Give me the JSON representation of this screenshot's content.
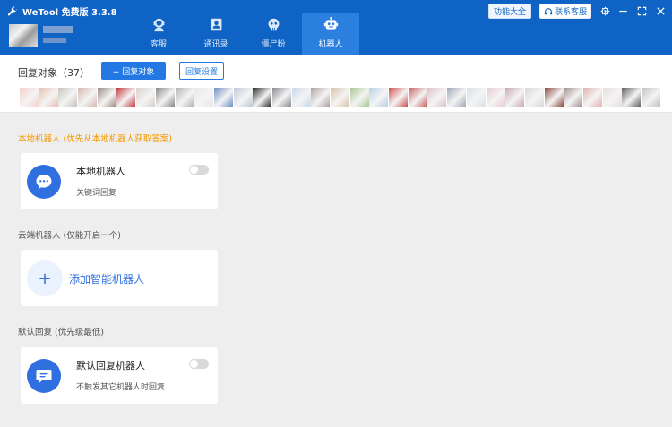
{
  "app": {
    "title": "WeTool 免费版 3.3.8"
  },
  "nav": {
    "tabs": [
      {
        "label": "客服",
        "icon": "customer-service-icon"
      },
      {
        "label": "通讯录",
        "icon": "contacts-icon"
      },
      {
        "label": "僵尸粉",
        "icon": "zombie-icon"
      },
      {
        "label": "机器人",
        "icon": "robot-icon",
        "active": true
      }
    ]
  },
  "header_buttons": {
    "features": "功能大全",
    "contact": "联系客服"
  },
  "targets": {
    "title": "回复对象（37）",
    "add_button": "+ 回复对象",
    "settings_button": "回复设置",
    "avatar_colors": [
      "#f4d2c8",
      "#e6c2b2",
      "#c8c2bc",
      "#d7b8b0",
      "#9a8a82",
      "#c03a40",
      "#d8d0cc",
      "#888",
      "#b5b0b0",
      "#e8e8e8",
      "#6e8fc3",
      "#c0c8d8",
      "#2a2a2a",
      "#8a8a90",
      "#c8d8e8",
      "#b0a0a0",
      "#d8c0a8",
      "#a8c890",
      "#b8d0e8",
      "#d05050",
      "#c86060",
      "#e0c0c8",
      "#a0a8b8",
      "#d8e0e8",
      "#e8c8d0",
      "#c8a8b8",
      "#d8d8d8",
      "#8b4a40",
      "#a0908c",
      "#e0b0b0",
      "#e8e0dc",
      "#606060",
      "#c0c0c0"
    ],
    "count": 37
  },
  "sections": {
    "local": {
      "label": "本地机器人 (优先从本地机器人获取答案)",
      "card_title": "本地机器人",
      "card_sub": "关键词回复",
      "enabled": false
    },
    "cloud": {
      "label": "云端机器人 (仅能开启一个)",
      "add_label": "添加智能机器人"
    },
    "default": {
      "label": "默认回复 (优先级最低)",
      "card_title": "默认回复机器人",
      "card_sub": "不触发其它机器人时回复",
      "enabled": false
    }
  },
  "colors": {
    "header": "#0f63c5",
    "active_tab": "#2b7fdf",
    "accent": "#2478e4",
    "orange": "#f39800"
  }
}
